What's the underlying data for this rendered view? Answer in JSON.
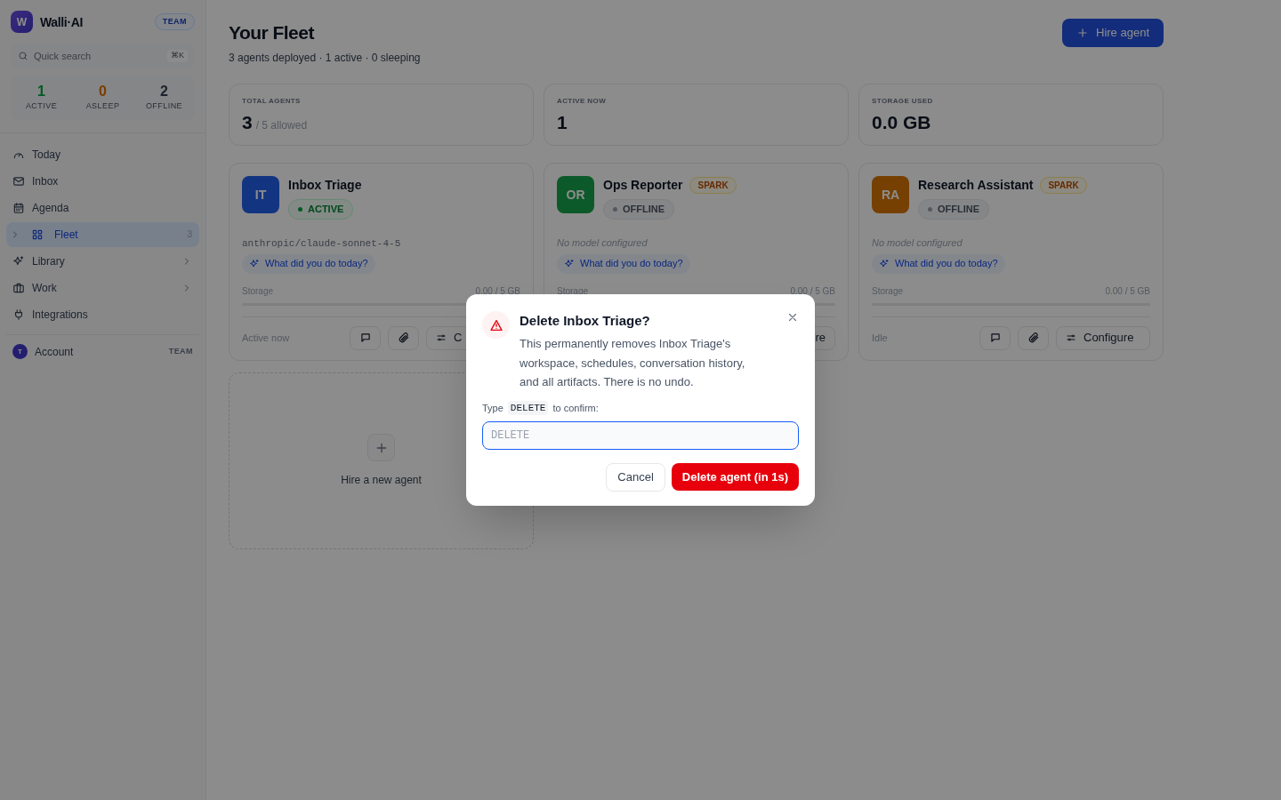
{
  "brand": {
    "logo": "W",
    "name": "Walli·AI",
    "badge": "TEAM"
  },
  "search": {
    "placeholder": "Quick search",
    "shortcut": "⌘K"
  },
  "counts": [
    {
      "value": "1",
      "label": "ACTIVE",
      "kind": "active"
    },
    {
      "value": "0",
      "label": "ASLEEP",
      "kind": "asleep"
    },
    {
      "value": "2",
      "label": "OFFLINE",
      "kind": "offline"
    }
  ],
  "nav": [
    {
      "label": "Today",
      "selected": false
    },
    {
      "label": "Inbox",
      "selected": false
    },
    {
      "label": "Agenda",
      "selected": false
    },
    {
      "label": "Fleet",
      "selected": true,
      "count": "3",
      "expandable": true
    },
    {
      "label": "Library",
      "selected": false,
      "chevron": true
    },
    {
      "label": "Work",
      "selected": false,
      "chevron": true
    },
    {
      "label": "Integrations",
      "selected": false
    }
  ],
  "account": {
    "avatar": "T",
    "label": "Account",
    "badge": "TEAM"
  },
  "header": {
    "title": "Your Fleet",
    "subtitle": "3 agents deployed · 1 active · 0 sleeping",
    "button": "Hire agent"
  },
  "stats": [
    {
      "label": "TOTAL AGENTS",
      "value": "3",
      "suffix": "/ 5 allowed"
    },
    {
      "label": "ACTIVE NOW",
      "value": "1"
    },
    {
      "label": "STORAGE USED",
      "value": "0.0 GB"
    }
  ],
  "agents": [
    {
      "initials": "IT",
      "color": "#143681",
      "name": "Inbox Triage",
      "status": "ACTIVE",
      "active": true,
      "model": "anthropic/claude-sonnet-4-5",
      "prompt": "What did you do today?",
      "storage_label": "Storage",
      "storage_value": "0.00 / 5 GB",
      "footer": {
        "status": "Active now",
        "buttons": true,
        "configure": "C"
      }
    },
    {
      "initials": "OR",
      "color": "#0c5a29",
      "name": "Ops Reporter",
      "tier": "SPARK",
      "status": "OFFLINE",
      "active": false,
      "model_missing": "No model configured",
      "prompt": "What did you do today?",
      "storage_label": "Storage",
      "storage_value": "0.00 / 5 GB",
      "footer": {
        "configure": "re"
      }
    },
    {
      "initials": "RA",
      "color": "#774104",
      "name": "Research Assistant",
      "tier": "SPARK",
      "status": "OFFLINE",
      "active": false,
      "model_missing": "No model configured",
      "prompt": "What did you do today?",
      "storage_label": "Storage",
      "storage_value": "0.00 / 5 GB",
      "footer": {
        "status": "Idle",
        "buttons": true,
        "configure": "Configure"
      }
    }
  ],
  "hire_card": {
    "label": "Hire a new agent"
  },
  "dialog": {
    "title": "Delete Inbox Triage?",
    "body": "This permanently removes Inbox Triage's workspace, schedules, conversation history, and all artifacts. There is no undo.",
    "prompt_before": "Type",
    "keyword": "DELETE",
    "prompt_after": "to confirm:",
    "placeholder": "DELETE",
    "cancel": "Cancel",
    "confirm": "Delete agent (in 1s)"
  }
}
